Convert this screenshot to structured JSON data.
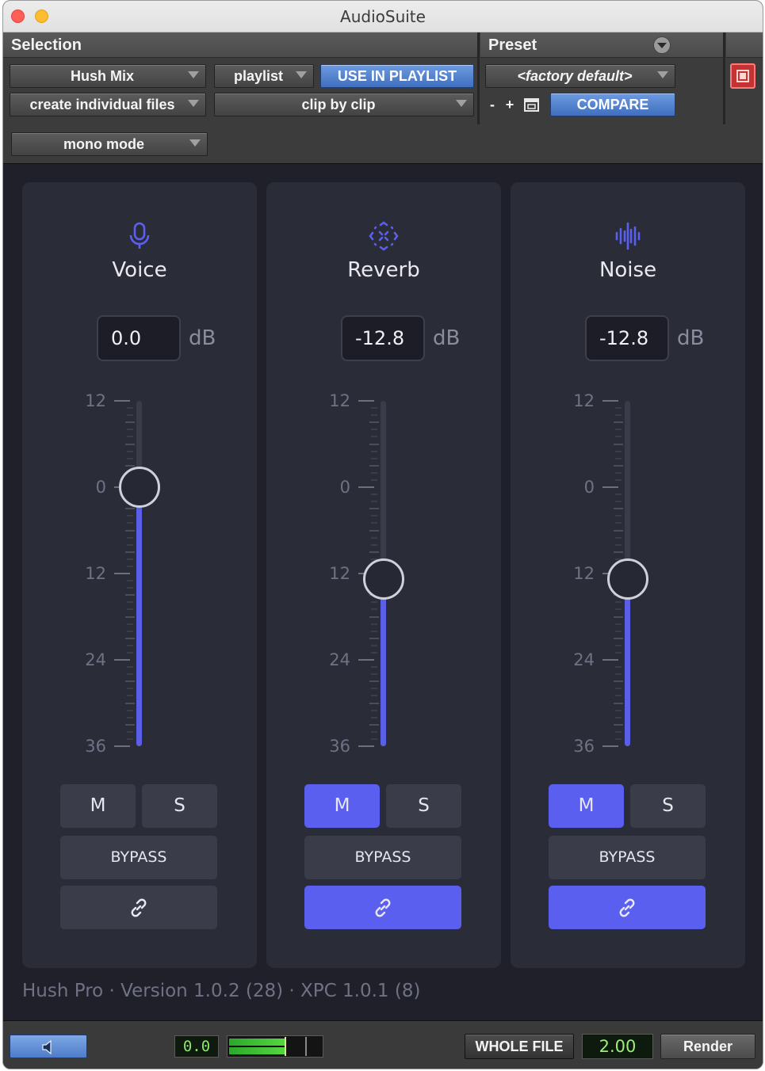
{
  "window": {
    "title": "AudioSuite"
  },
  "header": {
    "selection_label": "Selection",
    "preset_label": "Preset",
    "plugin_select": "Hush Mix",
    "playlist_select": "playlist",
    "use_in_playlist": "USE IN PLAYLIST",
    "file_mode_select": "create individual files",
    "process_mode_select": "clip by clip",
    "mono_mode_select": "mono mode",
    "preset_select": "<factory default>",
    "preset_minus": "-",
    "preset_plus": "+",
    "compare": "COMPARE"
  },
  "channels": [
    {
      "name": "Voice",
      "icon": "microphone-icon",
      "value": "0.0",
      "unit": "dB",
      "level_db": 0.0,
      "mute_active": false,
      "solo_active": false,
      "link_active": false,
      "mute_label": "M",
      "solo_label": "S",
      "bypass_label": "BYPASS"
    },
    {
      "name": "Reverb",
      "icon": "reverb-expand-icon",
      "value": "-12.8",
      "unit": "dB",
      "level_db": -12.8,
      "mute_active": true,
      "solo_active": false,
      "link_active": true,
      "mute_label": "M",
      "solo_label": "S",
      "bypass_label": "BYPASS"
    },
    {
      "name": "Noise",
      "icon": "noise-waveform-icon",
      "value": "-12.8",
      "unit": "dB",
      "level_db": -12.8,
      "mute_active": true,
      "solo_active": false,
      "link_active": true,
      "mute_label": "M",
      "solo_label": "S",
      "bypass_label": "BYPASS"
    }
  ],
  "fader_scale": [
    "12",
    "0",
    "12",
    "24",
    "36"
  ],
  "fader_range_db": [
    12,
    -36
  ],
  "version_text": "Hush Pro · Version 1.0.2 (28) · XPC 1.0.1 (8)",
  "footer": {
    "gain": "0.0",
    "whole_file": "WHOLE FILE",
    "handle_length": "2.00",
    "render": "Render"
  },
  "colors": {
    "accent": "#5b5ff0",
    "card": "#2a2c38",
    "background": "#1f2029",
    "pt_blue": "#4d7cc8"
  }
}
